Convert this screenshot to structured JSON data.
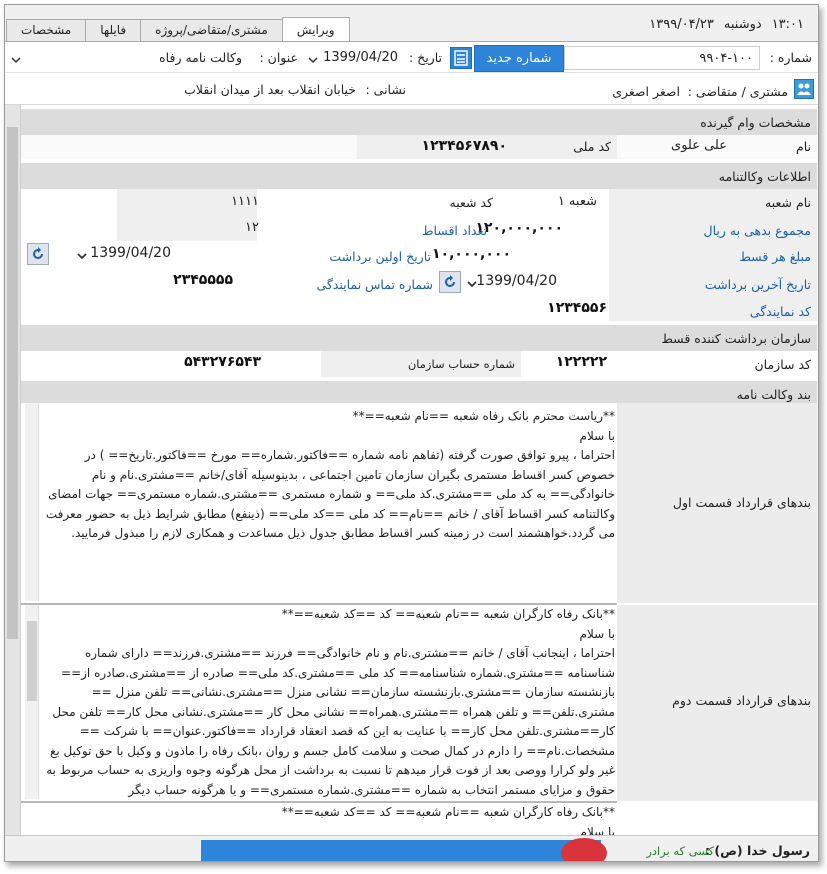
{
  "header": {
    "time": "۱۳:۰۱",
    "weekday": "دوشنبه",
    "date": "۱۳۹۹/۰۴/۲۳"
  },
  "tabs": [
    {
      "label": "ویرایش",
      "active": true
    },
    {
      "label": "مشتری/متقاضی/پروژه",
      "active": false
    },
    {
      "label": "فایلها",
      "active": false
    },
    {
      "label": "مشخصات",
      "active": false
    }
  ],
  "form": {
    "number_label": "شماره :",
    "number_value": "۹۹۰۴-۱۰۰",
    "new_number_button": "شماره جدید",
    "date_label": "تاریخ :",
    "date_value": "1399/04/20",
    "title_label": "عنوان :",
    "title_value": "وکالت نامه رفاه",
    "customer_label": "مشتری / متقاضی :",
    "customer_value": "اصغر اصغری",
    "address_label": "نشانی :",
    "address_value": "خیابان انقلاب بعد از میدان انقلاب"
  },
  "borrower": {
    "header": "مشخصات وام گیرنده",
    "name_label": "نام",
    "name_value": "علی علوی",
    "national_id_label": "کد ملی",
    "national_id_value": "۱۲۳۴۵۶۷۸۹۰"
  },
  "power_of_attorney": {
    "header": "اطلاعات وکالتنامه",
    "branch_name_label": "نام شعبه",
    "branch_name_value": "شعبه ۱",
    "branch_code_label": "کد شعبه",
    "branch_code_value": "۱۱۱۱",
    "total_debt_label": "مجموع بدهی به ریال",
    "total_debt_value": "۱۲۰,۰۰۰,۰۰۰",
    "installments_label": "تعداد اقساط",
    "installments_value": "۱۲",
    "installment_amount_label": "مبلغ هر قسط",
    "installment_amount_value": "۱۰,۰۰۰,۰۰۰",
    "first_withdraw_label": "تاریخ اولین برداشت",
    "first_withdraw_value": "1399/04/20",
    "last_withdraw_label": "تاریخ آخرین برداشت",
    "last_withdraw_value": "1399/04/20",
    "agency_phone_label": "شماره تماس نمایندگی",
    "agency_phone_value": "۲۳۴۵۵۵۵",
    "agency_code_label": "کد نمایندگی",
    "agency_code_value": "۱۲۳۴۵۵۶"
  },
  "organization": {
    "header": "سازمان برداشت کننده قسط",
    "org_code_label": "کد سازمان",
    "org_code_value": "۱۲۲۲۲۲",
    "account_label": "شماره حساب سازمان",
    "account_value": "۵۴۳۲۷۶۵۴۳"
  },
  "clauses": {
    "header": "بند وکالت نامه",
    "part1_label": "بندهای قرارداد قسمت اول",
    "part1_lines": [
      "**رياست محترم بانک رفاه شعبه ==نام شعبه==**",
      "با سلام",
      "احتراما ، پیرو توافق صورت گرفته (تفاهم نامه شماره ==فاکتور.شماره== مورخ ==فاکتور.تاریخ== ) در خصوص کسر اقساط مستمری بگیران سازمان تامین اجتماعی ، بدینوسیله آقای/خانم ==مشتری.نام و نام خانوادگی== به کد ملی ==مشتری.کد ملی== و شماره مستمری ==مشتری.شماره مستمری== جهات امضای وکالتنامه کسر اقساط آقای / خانم ==نام== کد ملی ==کد ملی== (ذینفع) مطابق شرایط ذیل به حضور معرفت می گردد.خواهشمند است در زمینه کسر اقساط مطابق جدول ذیل مساعدت و همکاری لازم را مبذول فرمایید."
    ],
    "part2_label": "بندهای قرارداد قسمت دوم",
    "part2_lines": [
      "**بانک رفاه کارگران شعبه ==نام شعبه== کد ==کد شعبه==**",
      "با سلام",
      "احتراما ، اینجانب آقای / خانم ==مشتری.نام و نام خانوادگی== فرزند ==مشتری.فرزند== دارای شماره شناسنامه ==مشتری.شماره شناسنامه== کد ملی ==مشتری.کد ملی== صادره از ==مشتری.صادره از== بازنشسته سازمان ==مشتری.بازنشسته سازمان== نشانی منزل ==مشتری.نشانی== تلفن منزل == مشتری.تلفن== و تلفن همراه ==مشتری.همراه== نشانی محل کار ==مشتری.نشانی محل کار== تلفن محل کار==مشتری.تلفن محل کار== با عنایت به این که قصد انعقاد قرارداد ==فاکتور.عنوان== با شرکت == مشخصات.نام== را دارم در کمال صحت و سلامت کامل جسم و روان ،بانک رفاه را ماذون و وکیل با حق توکیل بغ غیر ولو کرارا ووصی بعد از فوت قرار میدهم تا نسبت به برداشت از محل هرگونه وجوه واریزی به حساب مربوط به حقوق و مزایای مستمر انتخاب به شماره ==مشتری.شماره مستمری== و یا هرگونه حساب دیگر"
    ],
    "part3_lines": [
      "**بانک رفاه کارگران شعبه ==نام شعبه== کد ==کد شعبه==**",
      "با سلام"
    ]
  },
  "footer": {
    "prophet_text": "رسول خدا (ص) :",
    "hadith_text": "کسی که برادر"
  }
}
